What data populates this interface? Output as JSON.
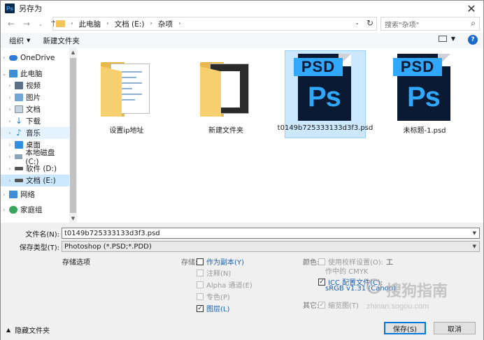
{
  "window": {
    "title": "另存为",
    "app_icon_text": "Ps"
  },
  "nav": {
    "back": "←",
    "forward": "→",
    "up": "↑"
  },
  "address": {
    "crumbs": [
      "此电脑",
      "文档 (E:)",
      "杂项"
    ],
    "separator": "›"
  },
  "search": {
    "placeholder": "搜索\"杂项\""
  },
  "toolbar": {
    "organize": "组织",
    "new_folder": "新建文件夹"
  },
  "sidebar": {
    "items": [
      {
        "label": "OneDrive",
        "icon": "cloud-icon"
      },
      {
        "label": "此电脑",
        "icon": "computer-icon"
      },
      {
        "label": "视频",
        "icon": "video-icon"
      },
      {
        "label": "图片",
        "icon": "picture-icon"
      },
      {
        "label": "文档",
        "icon": "document-icon"
      },
      {
        "label": "下载",
        "icon": "download-icon"
      },
      {
        "label": "音乐",
        "icon": "music-icon"
      },
      {
        "label": "桌面",
        "icon": "desktop-icon"
      },
      {
        "label": "本地磁盘 (C:)",
        "icon": "drive-icon"
      },
      {
        "label": "软件 (D:)",
        "icon": "drive-icon"
      },
      {
        "label": "文档 (E:)",
        "icon": "drive-icon"
      },
      {
        "label": "网络",
        "icon": "network-icon"
      },
      {
        "label": "家庭组",
        "icon": "homegroup-icon"
      }
    ]
  },
  "files": [
    {
      "name": "设置ip地址",
      "type": "folder"
    },
    {
      "name": "新建文件夹",
      "type": "folder"
    },
    {
      "name": "t0149b725333133d3f3.psd",
      "type": "psd"
    },
    {
      "name": "未标题-1.psd",
      "type": "psd"
    }
  ],
  "psd_icon": {
    "band": "PSD",
    "logo": "Ps"
  },
  "form": {
    "filename_label": "文件名(N):",
    "filename_value": "t0149b725333133d3f3.psd",
    "filetype_label": "保存类型(T):",
    "filetype_value": "Photoshop (*.PSD;*.PDD)",
    "save_options_label": "存储选项",
    "save_group_label": "存储:",
    "as_copy": "作为副本(Y)",
    "notes": "注释(N)",
    "alpha": "Alpha 通道(E)",
    "spot": "专色(P)",
    "layers": "图层(L)",
    "color_group_label": "颜色:",
    "use_proof": "使用校样设置(O):",
    "proof_value": "工",
    "working_cmyk": "作中的 CMYK",
    "icc": "ICC 配置文件(C):",
    "icc_value": "sRGB v1.31 (Canon)",
    "other_group_label": "其它:",
    "thumbnail": "缩览图(T)",
    "hide_folders": "隐藏文件夹",
    "save_button": "保存(S)",
    "cancel_button": "取消"
  },
  "watermark": {
    "text": "搜狗指南",
    "url": "zhinan.sogou.com"
  }
}
